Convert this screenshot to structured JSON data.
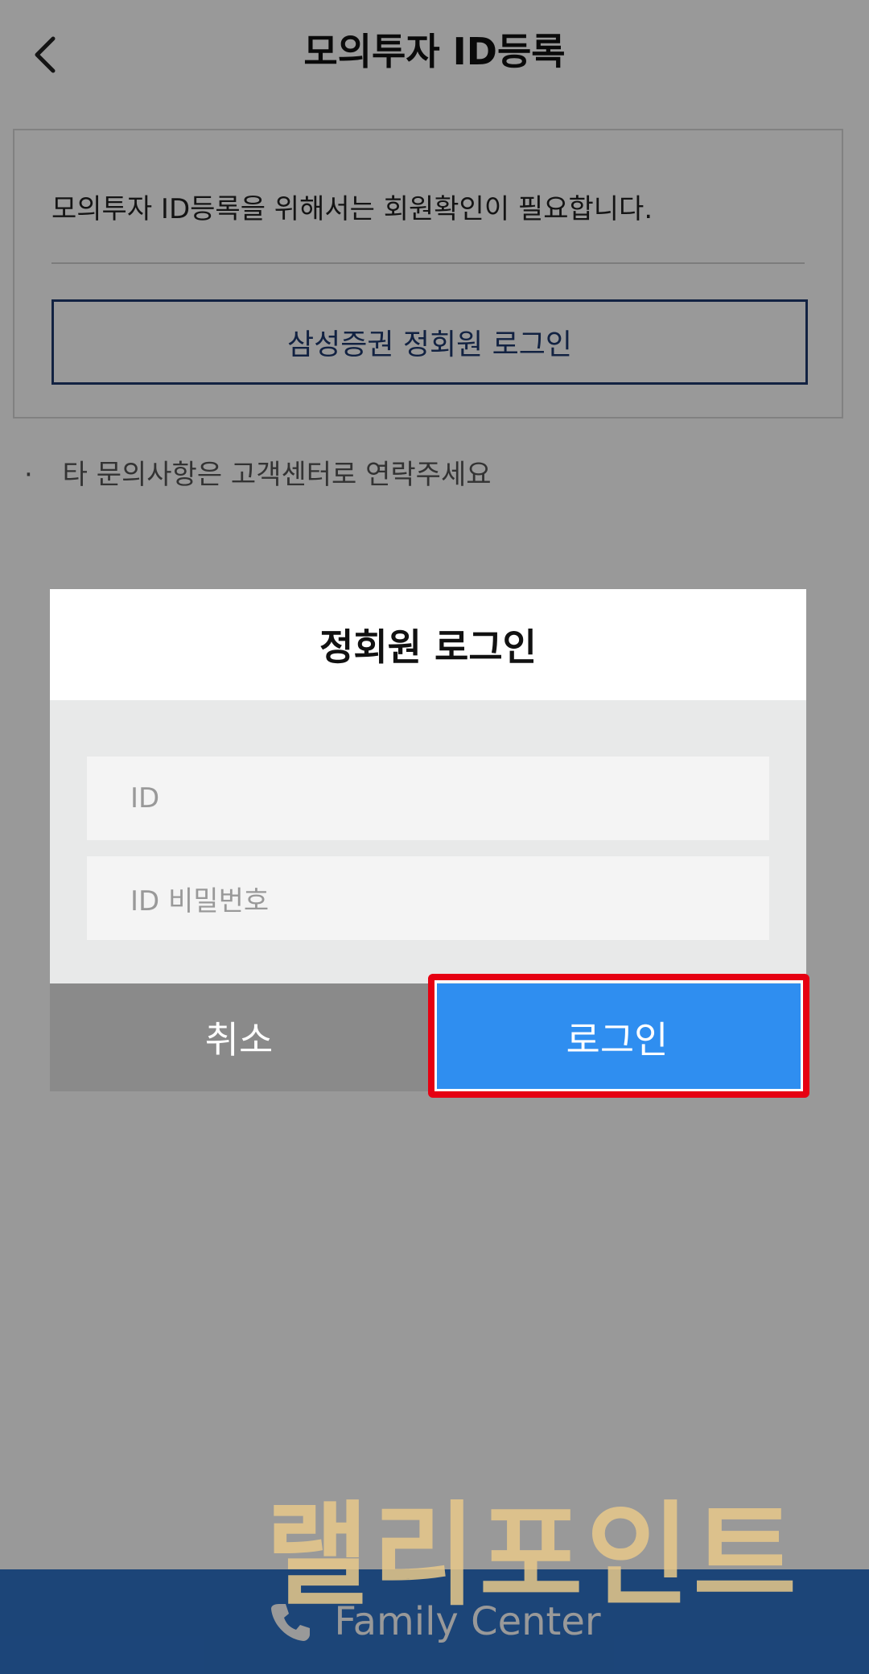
{
  "header": {
    "title": "모의투자 ID등록",
    "back_icon": "chevron-left-icon"
  },
  "info_card": {
    "message": "모의투자 ID등록을 위해서는 회원확인이 필요합니다.",
    "login_button": "삼성증권 정회원 로그인"
  },
  "notice": {
    "bullet": "·",
    "text": "타 문의사항은 고객센터로 연락주세요"
  },
  "dialog": {
    "title": "정회원 로그인",
    "id_placeholder": "ID",
    "password_placeholder": "ID 비밀번호",
    "cancel_label": "취소",
    "login_label": "로그인"
  },
  "footer": {
    "label": "Family Center",
    "icon": "phone-icon"
  },
  "watermark": {
    "text": "랠리포인트"
  },
  "colors": {
    "primary_button": "#2f8ef0",
    "cancel_button": "#8a8a8a",
    "footer_bar": "#2f73c9",
    "highlight_border": "#e60012"
  }
}
